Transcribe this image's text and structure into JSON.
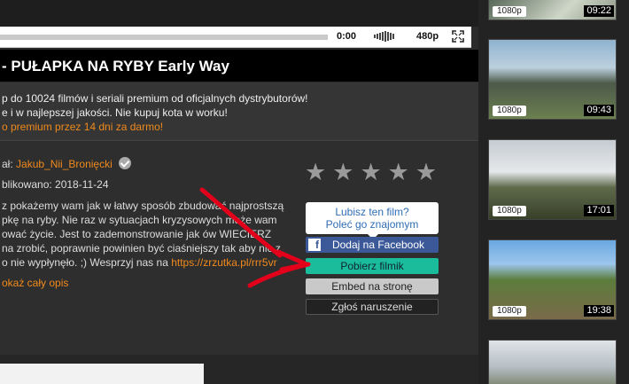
{
  "player": {
    "time": "0:00",
    "quality": "480p"
  },
  "video": {
    "title": "- PUŁAPKA NA RYBY Early Way"
  },
  "promo": {
    "line1": "p do 10024 filmów i seriali premium od oficjalnych dystrybutorów!",
    "line2": "e i w najlepszej jakości. Nie kupuj kota w worku!",
    "line3": "o premium przez 14 dni za darmo!"
  },
  "meta": {
    "author_label": "ał:",
    "author_name": "Jakub_Nii_Bronięcki",
    "published": "blikowano: 2018-11-24"
  },
  "description": {
    "l1": "z pokażemy wam jak w łatwy sposób zbudować najprostszą",
    "l2": "pkę na ryby. Nie raz w sytuacjach kryzysowych może wam",
    "l3": "ować życie. Jest to zademonstrowanie jak ów WIECIERZ",
    "l4": "na zrobić, poprawnie powinien być ciaśniejszy tak aby nic z",
    "l5a": "o nie wypłynęło. ;) Wesprzyj nas na ",
    "l5link": "https://zrzutka.pl/rrr5vr"
  },
  "show_more": "okaż cały opis",
  "share": {
    "line1": "Lubisz ten film?",
    "line2": "Poleć go znajomym",
    "facebook": "Dodaj na Facebook",
    "fb_letter": "f",
    "download": "Pobierz filmik",
    "embed": "Embed na stronę",
    "report": "Zgłoś naruszenie"
  },
  "rating": {
    "stars": [
      "★",
      "★",
      "★",
      "★",
      "★"
    ],
    "value": 0,
    "max": 5
  },
  "sidebar": {
    "thumbs": [
      {
        "badge": "1080p",
        "duration": "09:22"
      },
      {
        "badge": "1080p",
        "duration": "09:43"
      },
      {
        "badge": "1080p",
        "duration": "17:01"
      },
      {
        "badge": "1080p",
        "duration": "19:38"
      },
      {
        "badge": "",
        "duration": ""
      }
    ]
  },
  "colors": {
    "accent": "#f08a1c",
    "download": "#1abc9c",
    "facebook": "#3b5998",
    "arrow": "#e3001b"
  }
}
